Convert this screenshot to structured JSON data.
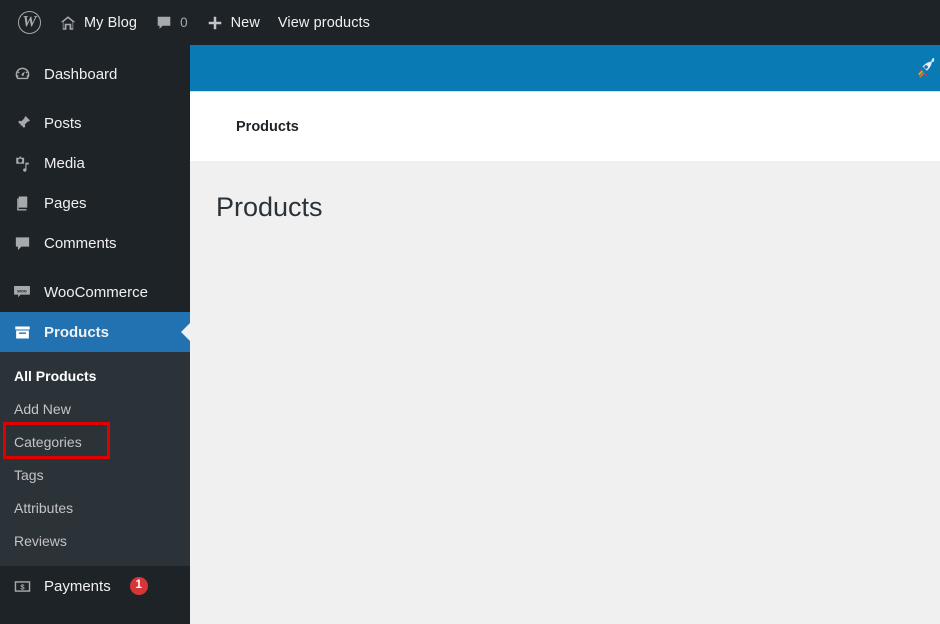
{
  "adminbar": {
    "logo_icon": "wordpress-logo-icon",
    "site_name": "My Blog",
    "site_icon": "home-icon",
    "comments_icon": "comment-bubble-icon",
    "comments_count": "0",
    "new_icon": "plus-icon",
    "new_label": "New",
    "view_products_label": "View products"
  },
  "sidebar": {
    "items": [
      {
        "label": "Dashboard",
        "icon": "dashboard-gauge-icon",
        "current": false
      },
      {
        "label": "Posts",
        "icon": "pin-icon",
        "current": false
      },
      {
        "label": "Media",
        "icon": "media-camera-music-icon",
        "current": false
      },
      {
        "label": "Pages",
        "icon": "pages-icon",
        "current": false
      },
      {
        "label": "Comments",
        "icon": "comment-bubble-icon",
        "current": false
      },
      {
        "label": "WooCommerce",
        "icon": "woocommerce-icon",
        "current": false
      },
      {
        "label": "Products",
        "icon": "products-box-icon",
        "current": true
      },
      {
        "label": "Payments",
        "icon": "payments-dollar-bill-icon",
        "current": false,
        "badge": "1"
      }
    ],
    "submenu": [
      {
        "label": "All Products",
        "current": true,
        "highlighted": true
      },
      {
        "label": "Add New",
        "current": false
      },
      {
        "label": "Categories",
        "current": false
      },
      {
        "label": "Tags",
        "current": false
      },
      {
        "label": "Attributes",
        "current": false
      },
      {
        "label": "Reviews",
        "current": false
      }
    ],
    "highlight_color": "#e00000",
    "current_color": "#2271b1",
    "background_color": "#1d2327",
    "submenu_background_color": "#2c3338"
  },
  "content": {
    "blue_bar_color": "#0a7ab5",
    "rocket_icon": "rocket-icon",
    "breadcrumb": "Products",
    "page_title": "Products",
    "background_color": "#f0f0f1"
  }
}
